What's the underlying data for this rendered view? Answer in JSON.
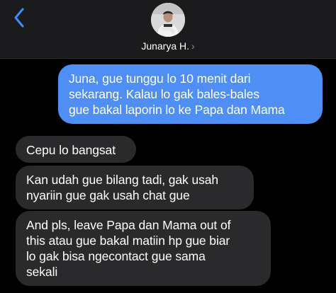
{
  "header": {
    "back_icon": "chevron-left-icon",
    "contact_name": "Junarya H.",
    "chevron": "›",
    "accent_color": "#3e8bff"
  },
  "messages": [
    {
      "direction": "sent",
      "text": "Juna, gue tunggu lo 10 menit dari\nsekarang. Kalau lo gak bales-bales\ngue bakal laporin lo ke Papa dan Mama"
    },
    {
      "direction": "received",
      "text": "Cepu lo bangsat"
    },
    {
      "direction": "received",
      "text": "Kan udah gue bilang tadi, gak usah\nnyariin gue gak usah chat gue"
    },
    {
      "direction": "received",
      "text": "And pls, leave Papa dan Mama out of\nthis atau gue bakal matiin hp gue biar\nlo gak bisa ngecontact gue sama\nsekali"
    }
  ],
  "colors": {
    "sent_bubble": "#4f8ef5",
    "received_bubble": "#2a2a2c",
    "background": "#000000",
    "header_background": "#1b1b1d"
  }
}
